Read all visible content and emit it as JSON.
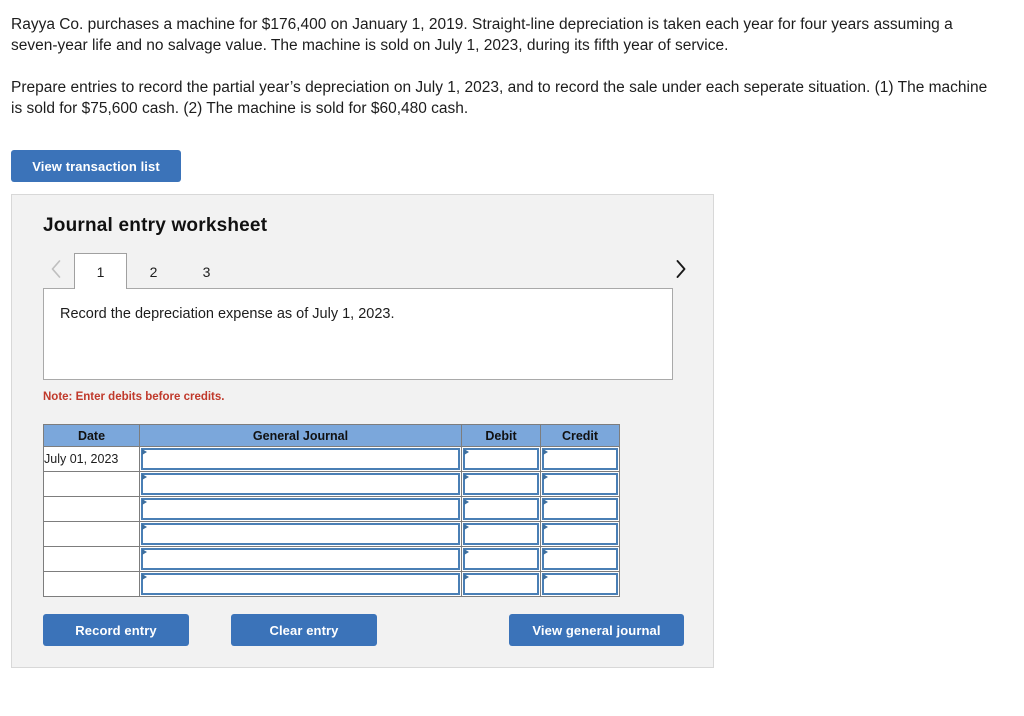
{
  "problem": {
    "paragraphs": [
      "Rayya Co. purchases a machine for $176,400 on January 1, 2019. Straight-line depreciation is taken each year for four years assuming a seven-year life and no salvage value. The machine is sold on July 1, 2023, during its fifth year of service.",
      "Prepare entries to record the partial year’s depreciation on July 1, 2023, and to record the sale under each seperate situation.  (1) The machine is sold for $75,600 cash. (2) The machine is sold for $60,480 cash."
    ]
  },
  "toolbar": {
    "view_transaction_list_label": "View transaction list"
  },
  "worksheet": {
    "title": "Journal entry worksheet",
    "tabs": [
      {
        "label": "1",
        "active": true
      },
      {
        "label": "2",
        "active": false
      },
      {
        "label": "3",
        "active": false
      }
    ],
    "prev_icon": "chevron-left-icon",
    "next_icon": "chevron-right-icon",
    "instruction": "Record the depreciation expense as of July 1, 2023.",
    "note": "Note: Enter debits before credits.",
    "table": {
      "headers": [
        "Date",
        "General Journal",
        "Debit",
        "Credit"
      ],
      "rows": [
        {
          "date": "July 01, 2023",
          "general_journal": "",
          "debit": "",
          "credit": ""
        },
        {
          "date": "",
          "general_journal": "",
          "debit": "",
          "credit": ""
        },
        {
          "date": "",
          "general_journal": "",
          "debit": "",
          "credit": ""
        },
        {
          "date": "",
          "general_journal": "",
          "debit": "",
          "credit": ""
        },
        {
          "date": "",
          "general_journal": "",
          "debit": "",
          "credit": ""
        },
        {
          "date": "",
          "general_journal": "",
          "debit": "",
          "credit": ""
        }
      ]
    },
    "actions": {
      "record_entry_label": "Record entry",
      "clear_entry_label": "Clear entry",
      "view_general_journal_label": "View general journal"
    }
  },
  "colors": {
    "button_blue": "#3b73b9",
    "table_header_blue": "#7ba7db",
    "field_border_blue": "#4a7fb5",
    "note_red": "#c0392b",
    "panel_bg": "#f2f2f2"
  }
}
